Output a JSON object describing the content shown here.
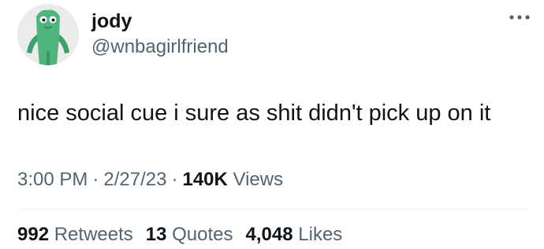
{
  "author": {
    "name": "jody",
    "handle": "@wnbagirlfriend"
  },
  "avatar_icon": "green-clay-figure-avatar",
  "more_icon": "more-options-dots",
  "tweet": {
    "text": "nice social cue i sure as shit didn't pick up on it"
  },
  "meta": {
    "time": "3:00 PM",
    "separator": "·",
    "date": "2/27/23",
    "views_count": "140K",
    "views_label": "Views"
  },
  "stats": {
    "retweets_count": "992",
    "retweets_label": "Retweets",
    "quotes_count": "13",
    "quotes_label": "Quotes",
    "likes_count": "4,048",
    "likes_label": "Likes"
  },
  "colors": {
    "text_primary": "#0f1419",
    "text_secondary": "#536471",
    "divider": "#eff3f4",
    "avatar_bg": "#e9e9e9",
    "avatar_figure": "#52b788"
  }
}
